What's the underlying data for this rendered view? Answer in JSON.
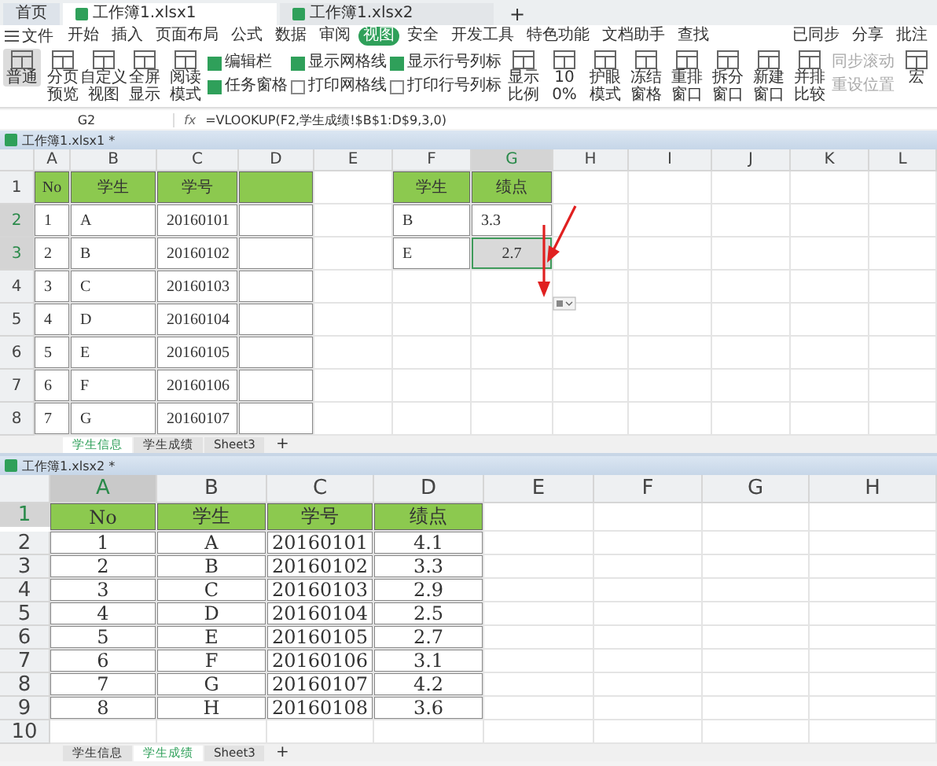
{
  "tabs": [
    {
      "label": "首页",
      "kind": "home",
      "selected": false
    },
    {
      "label": "工作簿1.xlsx1",
      "kind": "doc",
      "selected": true
    },
    {
      "label": "工作簿1.xlsx2",
      "kind": "doc",
      "selected": false
    },
    {
      "label": "+",
      "kind": "new",
      "selected": false
    }
  ],
  "menu": {
    "file": "文件",
    "items": [
      {
        "label": "开始",
        "selected": false
      },
      {
        "label": "插入",
        "selected": false
      },
      {
        "label": "页面布局",
        "selected": false
      },
      {
        "label": "公式",
        "selected": false
      },
      {
        "label": "数据",
        "selected": false
      },
      {
        "label": "审阅",
        "selected": false
      },
      {
        "label": "视图",
        "selected": true
      },
      {
        "label": "安全",
        "selected": false
      },
      {
        "label": "开发工具",
        "selected": false
      },
      {
        "label": "特色功能",
        "selected": false
      },
      {
        "label": "文档助手",
        "selected": false
      },
      {
        "label": "查找",
        "selected": false
      }
    ],
    "right": [
      "已同步",
      "分享",
      "批注"
    ]
  },
  "ribbon": [
    {
      "kind": "button",
      "label": "普通",
      "selected": true
    },
    {
      "kind": "button",
      "label": "分页预览",
      "selected": false
    },
    {
      "kind": "button",
      "label": "自定义视图",
      "selected": false
    },
    {
      "kind": "button",
      "label": "全屏显示",
      "selected": false
    },
    {
      "kind": "button",
      "label": "阅读模式",
      "selected": false
    },
    {
      "kind": "checks",
      "items": [
        {
          "label": "编辑栏",
          "checked": true
        },
        {
          "label": "任务窗格",
          "checked": true
        }
      ]
    },
    {
      "kind": "checks",
      "items": [
        {
          "label": "显示网格线",
          "checked": true
        },
        {
          "label": "打印网格线",
          "checked": false
        }
      ]
    },
    {
      "kind": "checks",
      "items": [
        {
          "label": "显示行号列标",
          "checked": true
        },
        {
          "label": "打印行号列标",
          "checked": false
        }
      ]
    },
    {
      "kind": "button",
      "label": "显示比例",
      "selected": false
    },
    {
      "kind": "button",
      "label": "100%",
      "selected": false
    },
    {
      "kind": "button",
      "label": "护眼模式",
      "selected": false
    },
    {
      "kind": "button",
      "label": "冻结窗格",
      "selected": false
    },
    {
      "kind": "button",
      "label": "重排窗口",
      "selected": false
    },
    {
      "kind": "button",
      "label": "拆分窗口",
      "selected": false
    },
    {
      "kind": "button",
      "label": "新建窗口",
      "selected": false
    },
    {
      "kind": "button",
      "label": "并排比较",
      "selected": false
    },
    {
      "kind": "stack",
      "items": [
        "同步滚动",
        "重设位置"
      ]
    },
    {
      "kind": "button",
      "label": "宏",
      "selected": false
    }
  ],
  "formula_bar": {
    "name_box": "G2",
    "fx": "fx",
    "formula": "=VLOOKUP(F2,学生成绩!$B$1:D$9,3,0)"
  },
  "windows": [
    {
      "title": "工作簿1.xlsx1 *",
      "annotations": true,
      "columns": [
        {
          "label": "A",
          "selected": false
        },
        {
          "label": "B",
          "selected": false
        },
        {
          "label": "C",
          "selected": false
        },
        {
          "label": "D",
          "selected": false
        },
        {
          "label": "E",
          "selected": false
        },
        {
          "label": "F",
          "selected": false
        },
        {
          "label": "G",
          "selected": true
        },
        {
          "label": "H",
          "selected": false
        },
        {
          "label": "I",
          "selected": false
        },
        {
          "label": "J",
          "selected": false
        },
        {
          "label": "K",
          "selected": false
        },
        {
          "label": "L",
          "selected": false
        }
      ],
      "rows": [
        {
          "label": "1",
          "selected": false,
          "cells": [
            {
              "text": "No",
              "kind": "header"
            },
            {
              "text": "学生",
              "kind": "header"
            },
            {
              "text": "学号",
              "kind": "header"
            },
            {
              "kind": "header"
            },
            {
              "kind": "blank"
            },
            {
              "text": "学生",
              "kind": "header"
            },
            {
              "text": "绩点",
              "kind": "header"
            }
          ]
        },
        {
          "label": "2",
          "selected": true,
          "cells": [
            {
              "text": "1",
              "kind": "data"
            },
            {
              "text": "A",
              "kind": "data"
            },
            {
              "text": "20160101",
              "kind": "data"
            },
            {
              "kind": "data"
            },
            {
              "kind": "blank"
            },
            {
              "text": "B",
              "kind": "data"
            },
            {
              "text": "3.3",
              "kind": "data"
            }
          ]
        },
        {
          "label": "3",
          "selected": true,
          "cells": [
            {
              "text": "2",
              "kind": "data"
            },
            {
              "text": "B",
              "kind": "data"
            },
            {
              "text": "20160102",
              "kind": "data"
            },
            {
              "kind": "data"
            },
            {
              "kind": "blank"
            },
            {
              "text": "E",
              "kind": "data"
            },
            {
              "text": "2.7",
              "kind": "selected"
            }
          ]
        },
        {
          "label": "4",
          "selected": false,
          "cells": [
            {
              "text": "3",
              "kind": "data"
            },
            {
              "text": "C",
              "kind": "data"
            },
            {
              "text": "20160103",
              "kind": "data"
            },
            {
              "kind": "data"
            }
          ]
        },
        {
          "label": "5",
          "selected": false,
          "cells": [
            {
              "text": "4",
              "kind": "data"
            },
            {
              "text": "D",
              "kind": "data"
            },
            {
              "text": "20160104",
              "kind": "data"
            },
            {
              "kind": "data"
            }
          ]
        },
        {
          "label": "6",
          "selected": false,
          "cells": [
            {
              "text": "5",
              "kind": "data"
            },
            {
              "text": "E",
              "kind": "data"
            },
            {
              "text": "20160105",
              "kind": "data"
            },
            {
              "kind": "data"
            }
          ]
        },
        {
          "label": "7",
          "selected": false,
          "cells": [
            {
              "text": "6",
              "kind": "data"
            },
            {
              "text": "F",
              "kind": "data"
            },
            {
              "text": "20160106",
              "kind": "data"
            },
            {
              "kind": "data"
            }
          ]
        },
        {
          "label": "8",
          "selected": false,
          "cells": [
            {
              "text": "7",
              "kind": "data"
            },
            {
              "text": "G",
              "kind": "data"
            },
            {
              "text": "20160107",
              "kind": "data"
            },
            {
              "kind": "data"
            }
          ]
        }
      ],
      "sheet_tabs": [
        {
          "label": "学生信息",
          "selected": true
        },
        {
          "label": "学生成绩",
          "selected": false
        },
        {
          "label": "Sheet3",
          "selected": false
        }
      ],
      "add_tab": "+"
    },
    {
      "title": "工作簿1.xlsx2 *",
      "annotations": false,
      "columns": [
        {
          "label": "A",
          "selected": true
        },
        {
          "label": "B",
          "selected": false
        },
        {
          "label": "C",
          "selected": false
        },
        {
          "label": "D",
          "selected": false
        },
        {
          "label": "E",
          "selected": false
        },
        {
          "label": "F",
          "selected": false
        },
        {
          "label": "G",
          "selected": false
        },
        {
          "label": "H",
          "selected": false
        }
      ],
      "rows": [
        {
          "label": "1",
          "selected": true,
          "cells": [
            {
              "text": "No",
              "kind": "header"
            },
            {
              "text": "学生",
              "kind": "header"
            },
            {
              "text": "学号",
              "kind": "header"
            },
            {
              "text": "绩点",
              "kind": "header"
            }
          ]
        },
        {
          "label": "2",
          "selected": false,
          "cells": [
            {
              "text": "1",
              "kind": "data"
            },
            {
              "text": "A",
              "kind": "data"
            },
            {
              "text": "20160101",
              "kind": "data"
            },
            {
              "text": "4.1",
              "kind": "data"
            }
          ]
        },
        {
          "label": "3",
          "selected": false,
          "cells": [
            {
              "text": "2",
              "kind": "data"
            },
            {
              "text": "B",
              "kind": "data"
            },
            {
              "text": "20160102",
              "kind": "data"
            },
            {
              "text": "3.3",
              "kind": "data"
            }
          ]
        },
        {
          "label": "4",
          "selected": false,
          "cells": [
            {
              "text": "3",
              "kind": "data"
            },
            {
              "text": "C",
              "kind": "data"
            },
            {
              "text": "20160103",
              "kind": "data"
            },
            {
              "text": "2.9",
              "kind": "data"
            }
          ]
        },
        {
          "label": "5",
          "selected": false,
          "cells": [
            {
              "text": "4",
              "kind": "data"
            },
            {
              "text": "D",
              "kind": "data"
            },
            {
              "text": "20160104",
              "kind": "data"
            },
            {
              "text": "2.5",
              "kind": "data"
            }
          ]
        },
        {
          "label": "6",
          "selected": false,
          "cells": [
            {
              "text": "5",
              "kind": "data"
            },
            {
              "text": "E",
              "kind": "data"
            },
            {
              "text": "20160105",
              "kind": "data"
            },
            {
              "text": "2.7",
              "kind": "data"
            }
          ]
        },
        {
          "label": "7",
          "selected": false,
          "cells": [
            {
              "text": "6",
              "kind": "data"
            },
            {
              "text": "F",
              "kind": "data"
            },
            {
              "text": "20160106",
              "kind": "data"
            },
            {
              "text": "3.1",
              "kind": "data"
            }
          ]
        },
        {
          "label": "8",
          "selected": false,
          "cells": [
            {
              "text": "7",
              "kind": "data"
            },
            {
              "text": "G",
              "kind": "data"
            },
            {
              "text": "20160107",
              "kind": "data"
            },
            {
              "text": "4.2",
              "kind": "data"
            }
          ]
        },
        {
          "label": "9",
          "selected": false,
          "cells": [
            {
              "text": "8",
              "kind": "data"
            },
            {
              "text": "H",
              "kind": "data"
            },
            {
              "text": "20160108",
              "kind": "data"
            },
            {
              "text": "3.6",
              "kind": "data"
            }
          ]
        },
        {
          "label": "10",
          "selected": false,
          "cells": []
        }
      ],
      "sheet_tabs": [
        {
          "label": "学生信息",
          "selected": false
        },
        {
          "label": "学生成绩",
          "selected": true
        },
        {
          "label": "Sheet3",
          "selected": false
        }
      ],
      "add_tab": "+"
    }
  ]
}
